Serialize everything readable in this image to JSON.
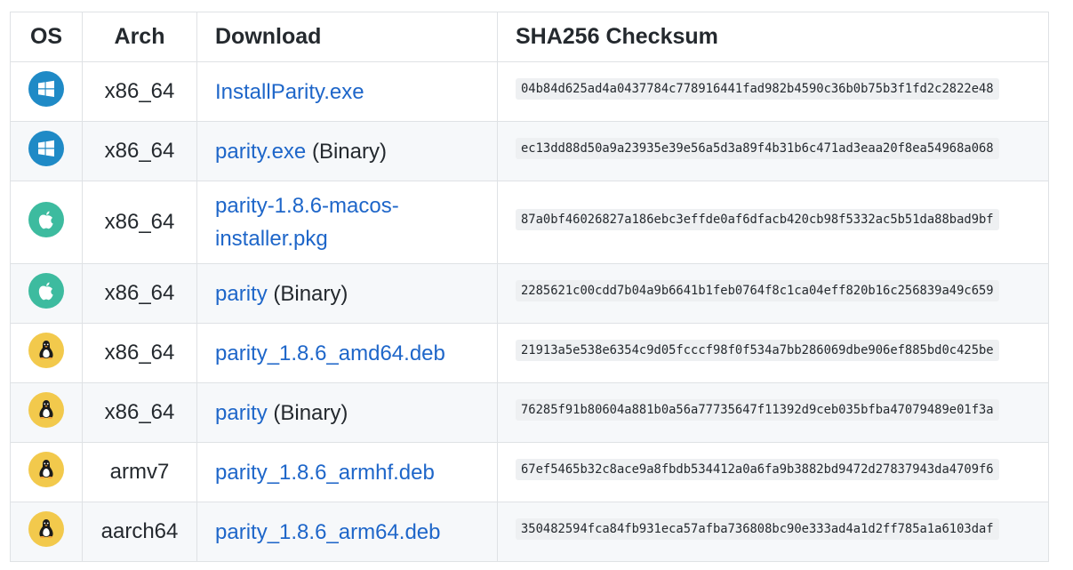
{
  "headers": {
    "os": "OS",
    "arch": "Arch",
    "download": "Download",
    "checksum": "SHA256 Checksum"
  },
  "rows": [
    {
      "os": "windows",
      "icon": "windows-icon",
      "arch": "x86_64",
      "link": "InstallParity.exe",
      "suffix": "",
      "sha": "04b84d625ad4a0437784c778916441fad982b4590c36b0b75b3f1fd2c2822e48"
    },
    {
      "os": "windows",
      "icon": "windows-icon",
      "arch": "x86_64",
      "link": "parity.exe",
      "suffix": " (Binary)",
      "sha": "ec13dd88d50a9a23935e39e56a5d3a89f4b31b6c471ad3eaa20f8ea54968a068"
    },
    {
      "os": "macos",
      "icon": "apple-icon",
      "arch": "x86_64",
      "link": "parity-1.8.6-macos-installer.pkg",
      "suffix": "",
      "sha": "87a0bf46026827a186ebc3effde0af6dfacb420cb98f5332ac5b51da88bad9bf"
    },
    {
      "os": "macos",
      "icon": "apple-icon",
      "arch": "x86_64",
      "link": "parity",
      "suffix": " (Binary)",
      "sha": "2285621c00cdd7b04a9b6641b1feb0764f8c1ca04eff820b16c256839a49c659"
    },
    {
      "os": "linux",
      "icon": "linux-penguin-icon",
      "arch": "x86_64",
      "link": "parity_1.8.6_amd64.deb",
      "suffix": "",
      "sha": "21913a5e538e6354c9d05fcccf98f0f534a7bb286069dbe906ef885bd0c425be"
    },
    {
      "os": "linux",
      "icon": "linux-penguin-icon",
      "arch": "x86_64",
      "link": "parity",
      "suffix": " (Binary)",
      "sha": "76285f91b80604a881b0a56a77735647f11392d9ceb035bfba47079489e01f3a"
    },
    {
      "os": "linux",
      "icon": "linux-penguin-icon",
      "arch": "armv7",
      "link": "parity_1.8.6_armhf.deb",
      "suffix": "",
      "sha": "67ef5465b32c8ace9a8fbdb534412a0a6fa9b3882bd9472d27837943da4709f6"
    },
    {
      "os": "linux",
      "icon": "linux-penguin-icon",
      "arch": "aarch64",
      "link": "parity_1.8.6_arm64.deb",
      "suffix": "",
      "sha": "350482594fca84fb931eca57afba736808bc90e333ad4a1d2ff785a1a6103daf"
    }
  ]
}
